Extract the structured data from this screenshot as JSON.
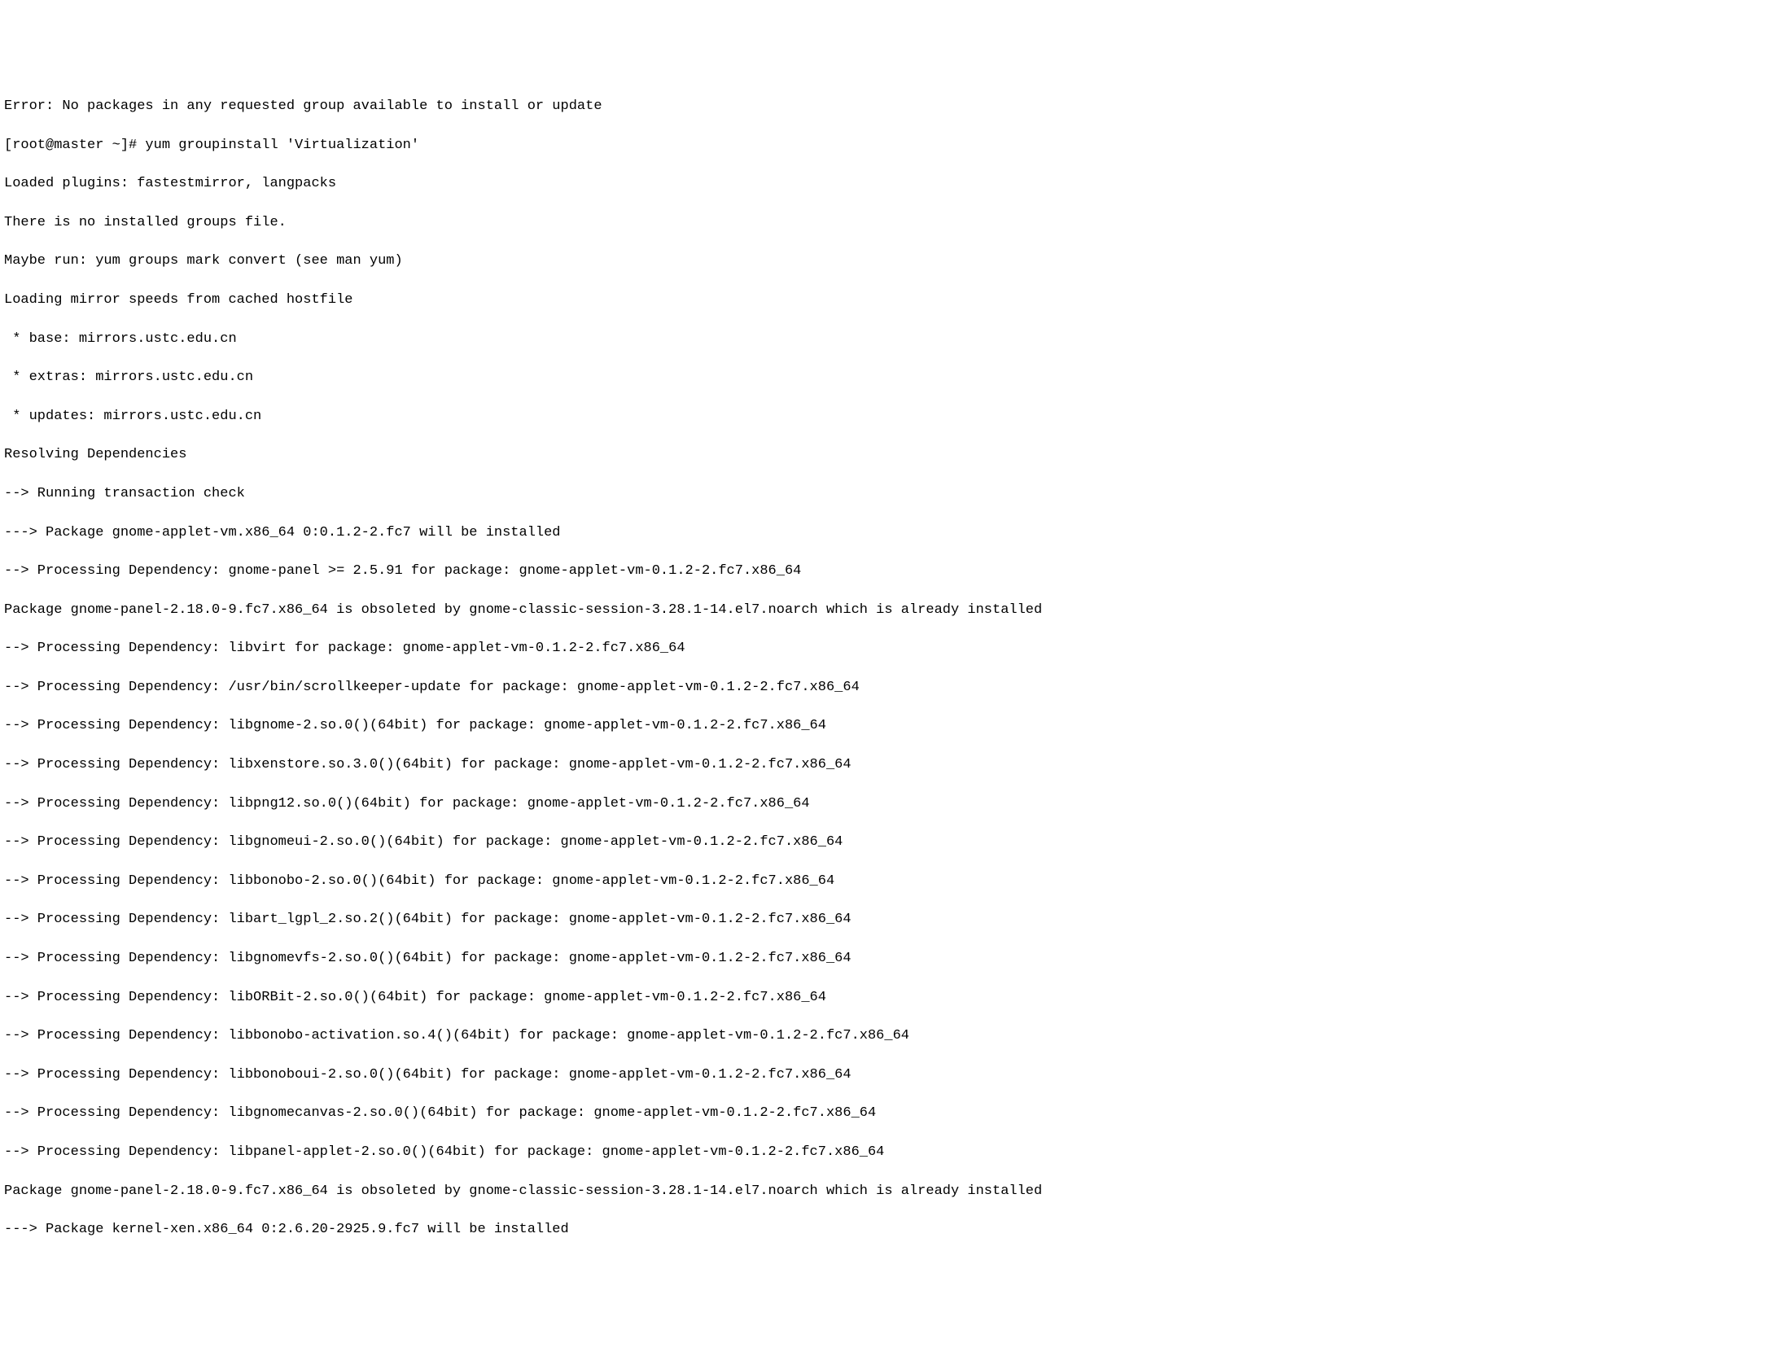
{
  "terminal": {
    "lines": [
      "Error: No packages in any requested group available to install or update",
      "[root@master ~]# yum groupinstall 'Virtualization'",
      "Loaded plugins: fastestmirror, langpacks",
      "There is no installed groups file.",
      "Maybe run: yum groups mark convert (see man yum)",
      "Loading mirror speeds from cached hostfile",
      " * base: mirrors.ustc.edu.cn",
      " * extras: mirrors.ustc.edu.cn",
      " * updates: mirrors.ustc.edu.cn",
      "Resolving Dependencies",
      "--> Running transaction check",
      "---> Package gnome-applet-vm.x86_64 0:0.1.2-2.fc7 will be installed",
      "--> Processing Dependency: gnome-panel >= 2.5.91 for package: gnome-applet-vm-0.1.2-2.fc7.x86_64",
      "Package gnome-panel-2.18.0-9.fc7.x86_64 is obsoleted by gnome-classic-session-3.28.1-14.el7.noarch which is already installed",
      "--> Processing Dependency: libvirt for package: gnome-applet-vm-0.1.2-2.fc7.x86_64",
      "--> Processing Dependency: /usr/bin/scrollkeeper-update for package: gnome-applet-vm-0.1.2-2.fc7.x86_64",
      "--> Processing Dependency: libgnome-2.so.0()(64bit) for package: gnome-applet-vm-0.1.2-2.fc7.x86_64",
      "--> Processing Dependency: libxenstore.so.3.0()(64bit) for package: gnome-applet-vm-0.1.2-2.fc7.x86_64",
      "--> Processing Dependency: libpng12.so.0()(64bit) for package: gnome-applet-vm-0.1.2-2.fc7.x86_64",
      "--> Processing Dependency: libgnomeui-2.so.0()(64bit) for package: gnome-applet-vm-0.1.2-2.fc7.x86_64",
      "--> Processing Dependency: libbonobo-2.so.0()(64bit) for package: gnome-applet-vm-0.1.2-2.fc7.x86_64",
      "--> Processing Dependency: libart_lgpl_2.so.2()(64bit) for package: gnome-applet-vm-0.1.2-2.fc7.x86_64",
      "--> Processing Dependency: libgnomevfs-2.so.0()(64bit) for package: gnome-applet-vm-0.1.2-2.fc7.x86_64",
      "--> Processing Dependency: libORBit-2.so.0()(64bit) for package: gnome-applet-vm-0.1.2-2.fc7.x86_64",
      "--> Processing Dependency: libbonobo-activation.so.4()(64bit) for package: gnome-applet-vm-0.1.2-2.fc7.x86_64",
      "--> Processing Dependency: libbonoboui-2.so.0()(64bit) for package: gnome-applet-vm-0.1.2-2.fc7.x86_64",
      "--> Processing Dependency: libgnomecanvas-2.so.0()(64bit) for package: gnome-applet-vm-0.1.2-2.fc7.x86_64",
      "--> Processing Dependency: libpanel-applet-2.so.0()(64bit) for package: gnome-applet-vm-0.1.2-2.fc7.x86_64",
      "Package gnome-panel-2.18.0-9.fc7.x86_64 is obsoleted by gnome-classic-session-3.28.1-14.el7.noarch which is already installed",
      "---> Package kernel-xen.x86_64 0:2.6.20-2925.9.fc7 will be installed"
    ]
  }
}
